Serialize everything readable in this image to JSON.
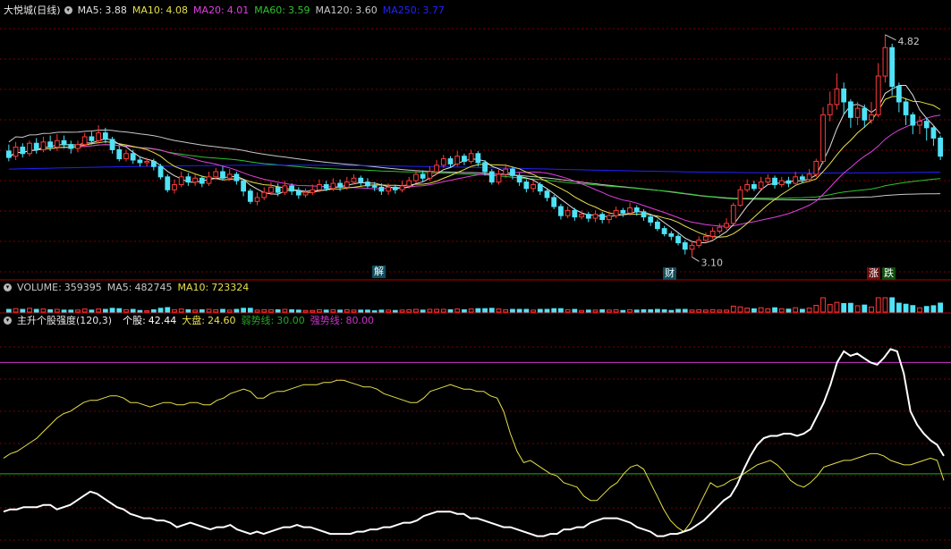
{
  "colors": {
    "up": "#ff3a3a",
    "down": "#4fe3f7",
    "grid": "#7a0000",
    "ma5": "#e0e0e0",
    "ma10": "#e6e04a",
    "ma20": "#e040e0",
    "ma60": "#2ec42e",
    "ma120": "#c8c8c8",
    "ma250": "#2222ff",
    "weak": "#22aa22",
    "strong": "#cc33cc",
    "stock": "#ffffff",
    "market": "#e6e04a"
  },
  "price_panel": {
    "title": "大悦城(日线)",
    "mas": [
      {
        "label": "MA5:",
        "value": "3.88",
        "color": "#e0e0e0"
      },
      {
        "label": "MA10:",
        "value": "4.08",
        "color": "#e6e04a"
      },
      {
        "label": "MA20:",
        "value": "4.01",
        "color": "#e040e0"
      },
      {
        "label": "MA60:",
        "value": "3.59",
        "color": "#2ec42e"
      },
      {
        "label": "MA120:",
        "value": "3.60",
        "color": "#c8c8c8"
      },
      {
        "label": "MA250:",
        "value": "3.77",
        "color": "#2222ff"
      }
    ],
    "high_label": "4.82",
    "low_label": "3.10",
    "tags": {
      "jie": "解",
      "cai": "财",
      "zhang": "涨",
      "die": "跌"
    }
  },
  "volume_panel": {
    "items": [
      {
        "label": "VOLUME:",
        "value": "359395",
        "color": "#c8c8c8"
      },
      {
        "label": "MA5:",
        "value": "482745",
        "color": "#c8c8c8"
      },
      {
        "label": "MA10:",
        "value": "723324",
        "color": "#e6e04a"
      }
    ]
  },
  "indicator_panel": {
    "title": "主升个股强度(120,3)",
    "items": [
      {
        "label": "个股:",
        "value": "42.44",
        "color": "#ffffff"
      },
      {
        "label": "大盘:",
        "value": "24.60",
        "color": "#e6e04a"
      },
      {
        "label": "弱势线:",
        "value": "30.00",
        "color": "#22aa22"
      },
      {
        "label": "强势线:",
        "value": "80.00",
        "color": "#cc33cc"
      }
    ]
  },
  "chart_data": {
    "type": "candlestick",
    "price_ylim": [
      2.93,
      4.95
    ],
    "weak_line": 30,
    "strong_line": 80,
    "indicator_ylim": [
      -3,
      95
    ],
    "candles": [
      [
        3.92,
        3.87,
        3.97,
        3.84
      ],
      [
        3.88,
        3.95,
        3.99,
        3.85
      ],
      [
        3.95,
        3.9,
        3.98,
        3.87
      ],
      [
        3.9,
        3.98,
        4.0,
        3.88
      ],
      [
        3.98,
        3.93,
        4.02,
        3.9
      ],
      [
        3.93,
        3.99,
        4.03,
        3.91
      ],
      [
        3.99,
        3.95,
        4.04,
        3.92
      ],
      [
        3.95,
        4.0,
        4.05,
        3.92
      ],
      [
        4.0,
        3.97,
        4.04,
        3.94
      ],
      [
        3.97,
        3.94,
        4.0,
        3.9
      ],
      [
        3.94,
        3.97,
        4.0,
        3.91
      ],
      [
        3.97,
        4.03,
        4.06,
        3.95
      ],
      [
        4.03,
        4.0,
        4.07,
        3.97
      ],
      [
        4.0,
        4.06,
        4.12,
        3.98
      ],
      [
        4.06,
        4.01,
        4.1,
        3.98
      ],
      [
        4.01,
        3.93,
        4.03,
        3.9
      ],
      [
        3.93,
        3.86,
        3.96,
        3.84
      ],
      [
        3.86,
        3.9,
        3.93,
        3.84
      ],
      [
        3.9,
        3.85,
        3.93,
        3.82
      ],
      [
        3.85,
        3.83,
        3.88,
        3.8
      ],
      [
        3.83,
        3.84,
        3.87,
        3.8
      ],
      [
        3.84,
        3.8,
        3.86,
        3.77
      ],
      [
        3.8,
        3.72,
        3.82,
        3.7
      ],
      [
        3.72,
        3.62,
        3.74,
        3.6
      ],
      [
        3.62,
        3.66,
        3.7,
        3.59
      ],
      [
        3.66,
        3.72,
        3.76,
        3.64
      ],
      [
        3.72,
        3.68,
        3.75,
        3.65
      ],
      [
        3.68,
        3.71,
        3.74,
        3.65
      ],
      [
        3.71,
        3.67,
        3.73,
        3.64
      ],
      [
        3.67,
        3.72,
        3.76,
        3.65
      ],
      [
        3.72,
        3.76,
        3.79,
        3.7
      ],
      [
        3.76,
        3.71,
        3.8,
        3.69
      ],
      [
        3.71,
        3.74,
        3.78,
        3.69
      ],
      [
        3.74,
        3.69,
        3.76,
        3.66
      ],
      [
        3.69,
        3.61,
        3.7,
        3.57
      ],
      [
        3.61,
        3.53,
        3.63,
        3.51
      ],
      [
        3.53,
        3.56,
        3.6,
        3.5
      ],
      [
        3.56,
        3.6,
        3.64,
        3.54
      ],
      [
        3.6,
        3.64,
        3.68,
        3.58
      ],
      [
        3.64,
        3.6,
        3.67,
        3.57
      ],
      [
        3.6,
        3.65,
        3.69,
        3.58
      ],
      [
        3.65,
        3.61,
        3.67,
        3.58
      ],
      [
        3.61,
        3.58,
        3.64,
        3.55
      ],
      [
        3.58,
        3.6,
        3.63,
        3.56
      ],
      [
        3.6,
        3.62,
        3.66,
        3.58
      ],
      [
        3.62,
        3.66,
        3.7,
        3.6
      ],
      [
        3.66,
        3.63,
        3.69,
        3.61
      ],
      [
        3.63,
        3.67,
        3.71,
        3.61
      ],
      [
        3.67,
        3.64,
        3.7,
        3.61
      ],
      [
        3.64,
        3.68,
        3.72,
        3.62
      ],
      [
        3.68,
        3.71,
        3.74,
        3.66
      ],
      [
        3.71,
        3.68,
        3.73,
        3.65
      ],
      [
        3.68,
        3.65,
        3.71,
        3.63
      ],
      [
        3.65,
        3.64,
        3.68,
        3.61
      ],
      [
        3.64,
        3.61,
        3.67,
        3.58
      ],
      [
        3.61,
        3.64,
        3.67,
        3.58
      ],
      [
        3.64,
        3.62,
        3.66,
        3.59
      ],
      [
        3.62,
        3.65,
        3.69,
        3.6
      ],
      [
        3.65,
        3.69,
        3.72,
        3.63
      ],
      [
        3.69,
        3.74,
        3.77,
        3.67
      ],
      [
        3.74,
        3.71,
        3.77,
        3.68
      ],
      [
        3.71,
        3.76,
        3.8,
        3.69
      ],
      [
        3.76,
        3.81,
        3.85,
        3.74
      ],
      [
        3.81,
        3.86,
        3.89,
        3.79
      ],
      [
        3.86,
        3.82,
        3.88,
        3.79
      ],
      [
        3.82,
        3.88,
        3.92,
        3.8
      ],
      [
        3.88,
        3.84,
        3.9,
        3.81
      ],
      [
        3.84,
        3.9,
        3.93,
        3.82
      ],
      [
        3.9,
        3.83,
        3.92,
        3.8
      ],
      [
        3.83,
        3.76,
        3.85,
        3.73
      ],
      [
        3.76,
        3.68,
        3.78,
        3.66
      ],
      [
        3.68,
        3.74,
        3.78,
        3.66
      ],
      [
        3.74,
        3.78,
        3.82,
        3.71
      ],
      [
        3.78,
        3.73,
        3.8,
        3.7
      ],
      [
        3.73,
        3.68,
        3.75,
        3.65
      ],
      [
        3.68,
        3.63,
        3.7,
        3.6
      ],
      [
        3.63,
        3.66,
        3.69,
        3.6
      ],
      [
        3.66,
        3.61,
        3.68,
        3.58
      ],
      [
        3.61,
        3.56,
        3.63,
        3.53
      ],
      [
        3.56,
        3.49,
        3.58,
        3.47
      ],
      [
        3.49,
        3.42,
        3.51,
        3.39
      ],
      [
        3.42,
        3.46,
        3.49,
        3.4
      ],
      [
        3.46,
        3.41,
        3.48,
        3.38
      ],
      [
        3.41,
        3.43,
        3.46,
        3.39
      ],
      [
        3.43,
        3.4,
        3.45,
        3.37
      ],
      [
        3.4,
        3.43,
        3.46,
        3.37
      ],
      [
        3.43,
        3.39,
        3.45,
        3.36
      ],
      [
        3.39,
        3.42,
        3.45,
        3.36
      ],
      [
        3.42,
        3.46,
        3.49,
        3.4
      ],
      [
        3.46,
        3.44,
        3.48,
        3.41
      ],
      [
        3.44,
        3.48,
        3.52,
        3.42
      ],
      [
        3.48,
        3.45,
        3.5,
        3.42
      ],
      [
        3.45,
        3.41,
        3.47,
        3.38
      ],
      [
        3.41,
        3.37,
        3.43,
        3.34
      ],
      [
        3.37,
        3.32,
        3.39,
        3.3
      ],
      [
        3.32,
        3.28,
        3.34,
        3.26
      ],
      [
        3.28,
        3.26,
        3.3,
        3.23
      ],
      [
        3.26,
        3.21,
        3.28,
        3.19
      ],
      [
        3.21,
        3.16,
        3.23,
        3.12
      ],
      [
        3.16,
        3.19,
        3.22,
        3.1
      ],
      [
        3.19,
        3.23,
        3.26,
        3.17
      ],
      [
        3.23,
        3.26,
        3.29,
        3.21
      ],
      [
        3.26,
        3.3,
        3.33,
        3.24
      ],
      [
        3.3,
        3.33,
        3.36,
        3.28
      ],
      [
        3.33,
        3.36,
        3.4,
        3.31
      ],
      [
        3.36,
        3.5,
        3.52,
        3.35
      ],
      [
        3.5,
        3.62,
        3.65,
        3.49
      ],
      [
        3.62,
        3.66,
        3.7,
        3.6
      ],
      [
        3.66,
        3.63,
        3.69,
        3.61
      ],
      [
        3.63,
        3.68,
        3.72,
        3.62
      ],
      [
        3.68,
        3.71,
        3.74,
        3.66
      ],
      [
        3.71,
        3.66,
        3.73,
        3.63
      ],
      [
        3.66,
        3.69,
        3.72,
        3.64
      ],
      [
        3.69,
        3.67,
        3.72,
        3.64
      ],
      [
        3.67,
        3.72,
        3.76,
        3.66
      ],
      [
        3.72,
        3.7,
        3.74,
        3.67
      ],
      [
        3.7,
        3.74,
        3.78,
        3.68
      ],
      [
        3.74,
        3.84,
        3.86,
        3.72
      ],
      [
        3.84,
        4.2,
        4.26,
        3.82
      ],
      [
        4.2,
        4.28,
        4.38,
        4.15
      ],
      [
        4.28,
        4.4,
        4.52,
        4.24
      ],
      [
        4.4,
        4.3,
        4.45,
        4.2
      ],
      [
        4.3,
        4.18,
        4.32,
        4.1
      ],
      [
        4.18,
        4.25,
        4.3,
        4.12
      ],
      [
        4.25,
        4.16,
        4.28,
        4.1
      ],
      [
        4.16,
        4.2,
        4.3,
        4.13
      ],
      [
        4.2,
        4.5,
        4.6,
        4.18
      ],
      [
        4.5,
        4.72,
        4.82,
        4.45
      ],
      [
        4.72,
        4.42,
        4.75,
        4.35
      ],
      [
        4.42,
        4.3,
        4.45,
        4.22
      ],
      [
        4.3,
        4.2,
        4.33,
        4.12
      ],
      [
        4.2,
        4.12,
        4.22,
        4.05
      ],
      [
        4.12,
        4.15,
        4.19,
        4.05
      ],
      [
        4.15,
        4.1,
        4.18,
        4.0
      ],
      [
        4.1,
        4.02,
        4.12,
        3.96
      ],
      [
        4.02,
        3.88,
        4.04,
        3.85
      ]
    ],
    "indicator_stock": [
      13,
      14,
      14,
      15,
      15,
      15,
      16,
      16,
      14,
      15,
      16,
      18,
      20,
      22,
      21,
      19,
      17,
      15,
      14,
      12,
      11,
      10,
      10,
      9,
      9,
      8,
      6,
      7,
      8,
      7,
      6,
      5,
      6,
      6,
      7,
      5,
      4,
      3,
      4,
      3,
      4,
      5,
      6,
      6,
      7,
      6,
      6,
      5,
      4,
      3,
      3,
      3,
      3,
      4,
      4,
      5,
      5,
      6,
      6,
      7,
      8,
      8,
      9,
      11,
      12,
      13,
      13,
      13,
      12,
      12,
      10,
      10,
      9,
      8,
      7,
      6,
      6,
      5,
      4,
      3,
      2,
      2,
      3,
      3,
      5,
      5,
      6,
      6,
      8,
      9,
      10,
      10,
      10,
      9,
      8,
      6,
      5,
      4,
      2,
      2,
      3,
      3,
      4,
      5,
      7,
      9,
      12,
      15,
      18,
      20,
      25,
      32,
      38,
      43,
      46,
      47,
      47,
      48,
      48,
      47,
      48,
      50,
      56,
      62,
      70,
      80,
      85,
      83,
      84,
      82,
      80,
      79,
      82,
      86,
      85,
      75,
      58,
      52,
      48,
      45,
      43,
      38
    ],
    "indicator_market": [
      37,
      39,
      40,
      42,
      44,
      46,
      49,
      52,
      55,
      57,
      58,
      60,
      62,
      63,
      63,
      64,
      65,
      65,
      64,
      62,
      62,
      61,
      60,
      61,
      62,
      62,
      61,
      61,
      62,
      62,
      61,
      61,
      63,
      64,
      66,
      67,
      68,
      67,
      64,
      64,
      66,
      67,
      67,
      68,
      69,
      70,
      70,
      70,
      71,
      71,
      72,
      72,
      71,
      70,
      69,
      69,
      68,
      66,
      65,
      64,
      63,
      62,
      62,
      64,
      67,
      68,
      69,
      70,
      69,
      68,
      68,
      67,
      67,
      65,
      64,
      58,
      48,
      40,
      35,
      36,
      34,
      32,
      30,
      29,
      26,
      25,
      24,
      20,
      18,
      18,
      21,
      24,
      26,
      30,
      33,
      34,
      32,
      26,
      20,
      14,
      9,
      6,
      4,
      8,
      14,
      20,
      26,
      24,
      25,
      27,
      28,
      30,
      32,
      34,
      35,
      36,
      34,
      31,
      27,
      25,
      24,
      26,
      29,
      33,
      34,
      35,
      36,
      36,
      37,
      38,
      39,
      39,
      38,
      36,
      35,
      34,
      34,
      35,
      36,
      37,
      36,
      27
    ]
  }
}
